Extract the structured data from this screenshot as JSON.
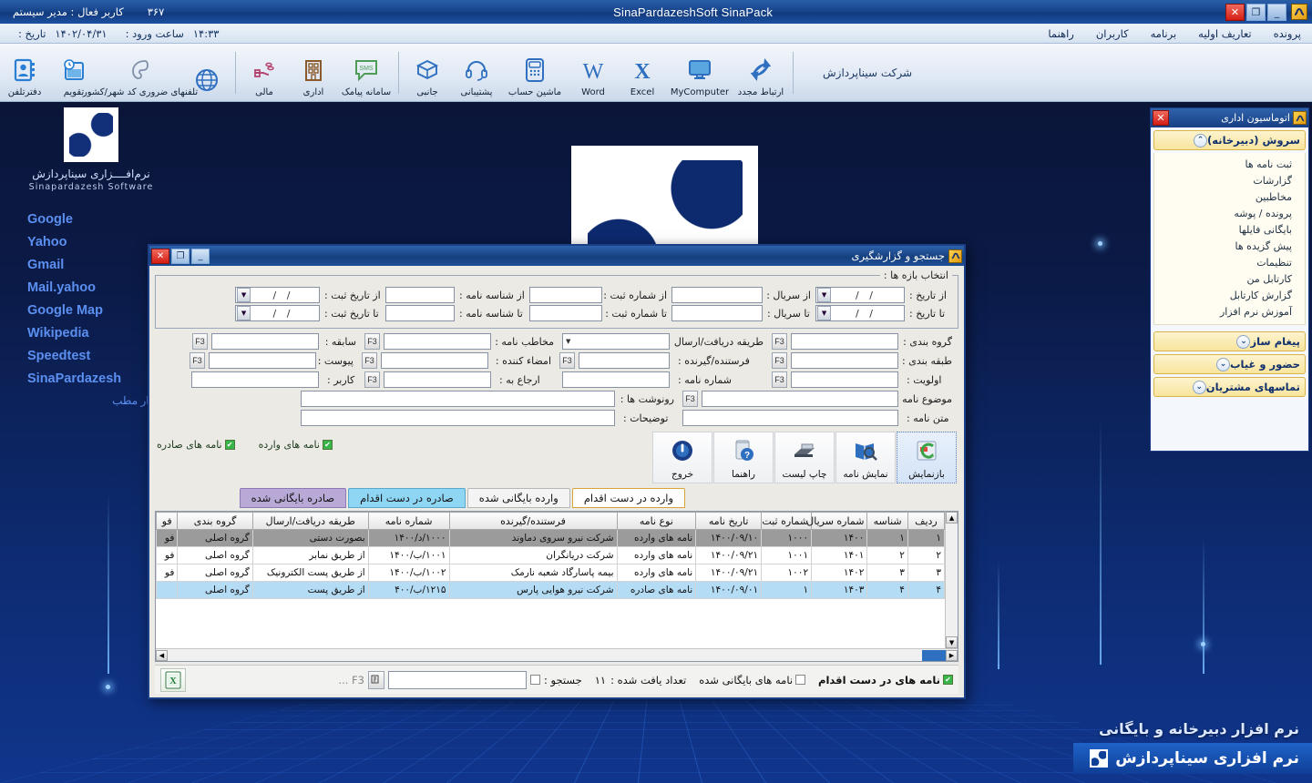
{
  "window": {
    "title": "SinaPardazeshSoft SinaPack",
    "user_label": "کاربر فعال : مدیر سیستم",
    "user_number": "۳۶۷",
    "minimize": "_",
    "maximize": "❐",
    "close": "✕",
    "app_icon": "sina-logo-icon"
  },
  "menubar": {
    "items": [
      {
        "label": "پرونده"
      },
      {
        "label": "تعاریف اولیه"
      },
      {
        "label": "برنامه"
      },
      {
        "label": "کاربران"
      },
      {
        "label": "راهنما"
      }
    ],
    "login_time_label": "ساعت ورود :",
    "login_time_value": "۱۴:۳۳",
    "date_label": "تاریخ :",
    "date_value": "۱۴۰۲/۰۴/۳۱"
  },
  "toolbar": {
    "company": "شرکت سیناپردازش",
    "items": [
      {
        "label": "دفترتلفن",
        "icon": "contacts-icon"
      },
      {
        "label": "تقویم",
        "icon": "calendar-icon"
      },
      {
        "label": "تلفنهای ضروری کد شهر/کشور",
        "icon": "globe-icon"
      },
      {
        "label": "",
        "icon": "phone-ear-icon"
      },
      {
        "label": "مالی",
        "icon": "hand-coin-icon"
      },
      {
        "label": "اداری",
        "icon": "building-icon"
      },
      {
        "label": "سامانه پیامک",
        "icon": "sms-icon"
      },
      {
        "label": "جانبی",
        "icon": "box-icon"
      },
      {
        "label": "پشتیبانی",
        "icon": "headset-icon"
      },
      {
        "label": "ماشین حساب",
        "icon": "calculator-icon"
      },
      {
        "label": "Word",
        "icon": "word-icon"
      },
      {
        "label": "Excel",
        "icon": "excel-icon"
      },
      {
        "label": "MyComputer",
        "icon": "monitor-icon"
      },
      {
        "label": "ارتباط مجدد",
        "icon": "reconnect-icon"
      }
    ]
  },
  "left_panel": {
    "logo_fa": "نرم‌افــــزاری سیناپردازش",
    "logo_en": "Sinapardazesh Software",
    "links": [
      {
        "label": "Google",
        "fa": false
      },
      {
        "label": "Yahoo",
        "fa": false
      },
      {
        "label": "Gmail",
        "fa": false
      },
      {
        "label": "Mail.yahoo",
        "fa": false
      },
      {
        "label": "Google Map",
        "fa": false
      },
      {
        "label": "Wikipedia",
        "fa": false
      },
      {
        "label": "Speedtest",
        "fa": false
      },
      {
        "label": "SinaPardazesh",
        "fa": false
      },
      {
        "label": "نرم افزار مطب",
        "fa": true
      }
    ]
  },
  "dock": {
    "title": "اتوماسیون اداری",
    "close": "✕",
    "groups": [
      {
        "label": "سروش (دبیرخانه)",
        "expanded": true,
        "chevron": "⌃",
        "items": [
          "ثبت نامه ها",
          "گزارشات",
          "مخاطبین",
          "پرونده / پوشه",
          "بایگانی فایلها",
          "پیش گزیده ها",
          "تنظیمات",
          "کارتابل من",
          "گزارش کارتابل",
          "آموزش نرم افزار"
        ]
      },
      {
        "label": "پیغام ساز",
        "expanded": false,
        "chevron": "⌄",
        "items": []
      },
      {
        "label": "حضور و غیاب",
        "expanded": false,
        "chevron": "⌄",
        "items": []
      },
      {
        "label": "تماسهای مشتریان",
        "expanded": false,
        "chevron": "⌄",
        "items": []
      }
    ]
  },
  "dialog": {
    "title": "جستجو و گزارشگیری",
    "minimize": "_",
    "maximize": "❐",
    "close": "✕",
    "range": {
      "legend": "انتخاب بازه ها :",
      "rows": [
        {
          "date_label": "از تاریخ :",
          "date_value": "    /    /",
          "serial_label": "از سریال :",
          "serial_value": "",
          "regnum_label": "از شماره ثبت :",
          "regnum_value": "",
          "letterid_label": "از شناسه نامه :",
          "letterid_value": "",
          "regdate_label": "از تاریخ ثبت :",
          "regdate_value": "    /    /"
        },
        {
          "date_label": "تا تاریخ :",
          "date_value": "    /    /",
          "serial_label": "تا سریال :",
          "serial_value": "",
          "regnum_label": "تا شماره ثبت :",
          "regnum_value": "",
          "letterid_label": "تا شناسه نامه :",
          "letterid_value": "",
          "regdate_label": "تا تاریخ ثبت :",
          "regdate_value": "    /    /"
        }
      ]
    },
    "fields": {
      "group_label": "گروه بندی :",
      "group_value": "",
      "method_label": "طریقه دریافت/ارسال :",
      "method_value": "",
      "addressee_label": "مخاطب نامه :",
      "addressee_value": "",
      "history_label": "سابقه :",
      "history_value": "",
      "class_label": "طبقه بندی :",
      "class_value": "",
      "sender_label": "فرستنده/گیرنده :",
      "sender_value": "",
      "signer_label": "امضاء کننده :",
      "signer_value": "",
      "attach_label": "پیوست :",
      "attach_value": "",
      "priority_label": "اولویت :",
      "priority_value": "",
      "letternum_label": "شماره نامه :",
      "letternum_value": "",
      "referto_label": "ارجاع به :",
      "referto_value": "",
      "user_label": "کاربر :",
      "user_value": "",
      "subject_label": "موضوع نامه :",
      "subject_value": "",
      "copies_label": "رونوشت ها :",
      "copies_value": "",
      "body_label": "متن نامه :",
      "body_value": "",
      "desc_label": "توضیحات :",
      "desc_value": "",
      "f3_hint": "F3"
    },
    "buttons": [
      {
        "label": "بازنمایش",
        "icon": "refresh-image-icon",
        "selected": true
      },
      {
        "label": "نمایش نامه",
        "icon": "preview-letter-icon",
        "selected": false
      },
      {
        "label": "چاپ لیست",
        "icon": "printer-icon",
        "selected": false
      },
      {
        "label": "راهنما",
        "icon": "help-icon",
        "selected": false
      },
      {
        "label": "خروج",
        "icon": "power-exit-icon",
        "selected": false
      }
    ],
    "checkboxes": [
      {
        "label": "نامه های وارده",
        "checked": true
      },
      {
        "label": "نامه های صادره",
        "checked": true
      }
    ],
    "tabs": [
      {
        "label": "وارده در دست اقدام",
        "style": "t-orange"
      },
      {
        "label": "وارده بایگانی شده",
        "style": "t-plain"
      },
      {
        "label": "صادره در دست اقدام",
        "style": "t-blue"
      },
      {
        "label": "صادره بایگانی شده",
        "style": "t-purple"
      }
    ],
    "grid": {
      "columns": [
        "ردیف",
        "شناسه",
        "شماره سریال",
        "شماره ثبت",
        "تاریخ نامه",
        "نوع نامه",
        "فرستنده/گیرنده",
        "شماره نامه",
        "طریقه دریافت/ارسال",
        "گروه بندی",
        "فو"
      ],
      "rows": [
        {
          "selected": true,
          "cells": [
            "۱",
            "۱",
            "۱۴۰۰",
            "۱۰۰۰",
            "۱۴۰۰/۰۹/۱۰",
            "نامه های وارده",
            "شرکت نیرو سروی دماوند",
            "۱۰۰۰/د/۱۴۰۰",
            "بصورت دستی",
            "گروه اصلی",
            "فو"
          ]
        },
        {
          "selected": false,
          "cells": [
            "۲",
            "۲",
            "۱۴۰۱",
            "۱۰۰۱",
            "۱۴۰۰/۰۹/۲۱",
            "نامه های وارده",
            "شرکت دریانگران",
            "۱۰۰۱/ب/۱۴۰۰",
            "از طریق نمابر",
            "گروه اصلی",
            "فو"
          ]
        },
        {
          "selected": false,
          "cells": [
            "۳",
            "۳",
            "۱۴۰۲",
            "۱۰۰۲",
            "۱۴۰۰/۰۹/۲۱",
            "نامه های وارده",
            "بیمه پاسارگاد شعبه نارمک",
            "۱۰۰۲/ب/۱۴۰۰",
            "از طریق پست الکترونیک",
            "گروه اصلی",
            "فو"
          ]
        },
        {
          "selected": false,
          "highlight": true,
          "cells": [
            "۴",
            "۴",
            "۱۴۰۳",
            "۱",
            "۱۴۰۰/۰۹/۰۱",
            "نامه های صادره",
            "شرکت نیرو هوایی پارس",
            "۱۲۱۵/ب/۴۰۰",
            "از طریق پست",
            "گروه اصلی",
            ""
          ]
        }
      ]
    },
    "bottom": {
      "inaction_label": "نامه های در دست اقدام",
      "inaction_checked": true,
      "archived_label": "نامه های بایگانی شده",
      "archived_checked": false,
      "found_label": "تعداد یافت شده :",
      "found_value": "۱۱",
      "search_label": "جستجو :",
      "search_value": "",
      "search_checked": false,
      "f3_hint": "F3 ...",
      "excel_icon": "excel-export-icon",
      "pick_icon": "picker-icon"
    }
  },
  "branding": {
    "line1": "نرم افزار دبیرخانه و بایگانی",
    "line2": "نرم افزاری سیناپردازش"
  },
  "colors": {
    "title_blue": "#16407f",
    "accent_gold": "#f8e49b",
    "link_blue": "#5b8ff0",
    "tab_blue": "#8fd6f5",
    "tab_purple": "#b9a9d6",
    "selected_row": "#9b9b9b",
    "highlight_row": "#b5dcf5",
    "check_green": "#39b54a"
  }
}
